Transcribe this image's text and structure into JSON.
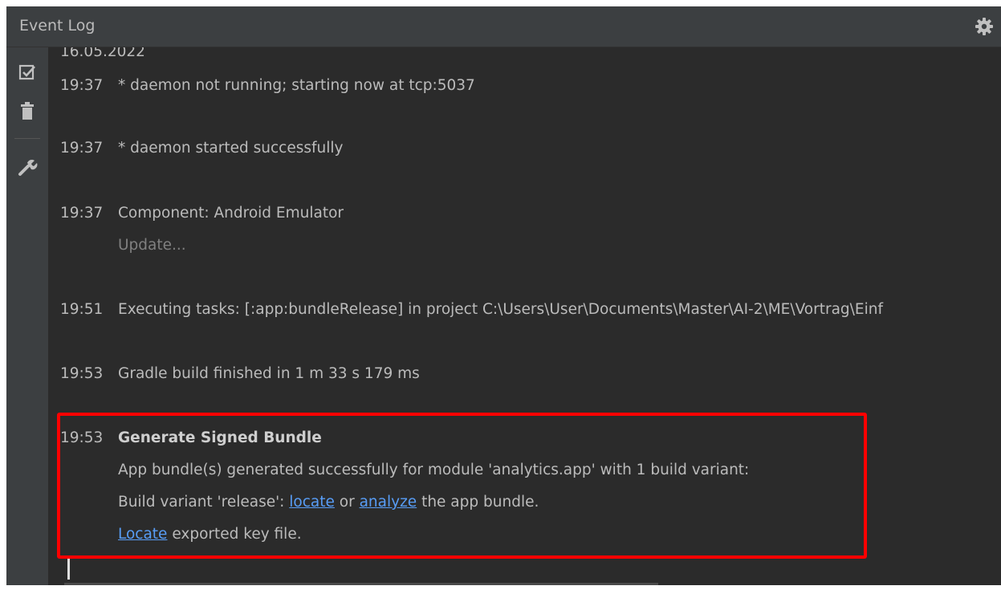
{
  "window": {
    "title": "Event Log"
  },
  "icons": {
    "settings": "gear-icon",
    "mark_read": "mark-all-read-icon",
    "clear": "trash-icon",
    "settings_tool": "wrench-icon"
  },
  "colors": {
    "background": "#2b2b2b",
    "panel": "#3c3f41",
    "text": "#bbbbbb",
    "muted": "#808080",
    "link": "#589df6",
    "highlight": "#ff0000"
  },
  "log": {
    "date": "16.05.2022",
    "entries": [
      {
        "time": "19:37",
        "message": "* daemon not running; starting now at tcp:5037"
      },
      {
        "time": "19:37",
        "message": "* daemon started successfully"
      },
      {
        "time": "19:37",
        "message": "Component: Android Emulator",
        "sub": "Update..."
      },
      {
        "time": "19:51",
        "message": "Executing tasks: [:app:bundleRelease] in project C:\\Users\\User\\Documents\\Master\\AI-2\\ME\\Vortrag\\Einf"
      },
      {
        "time": "19:53",
        "message": "Gradle build finished in 1 m 33 s 179 ms"
      }
    ],
    "bundle": {
      "time": "19:53",
      "title": "Generate Signed Bundle",
      "line1": "App bundle(s) generated successfully for module 'analytics.app' with 1 build variant:",
      "line2_prefix": "Build variant 'release': ",
      "link_locate": "locate",
      "line2_or": " or ",
      "link_analyze": "analyze",
      "line2_suffix": " the app bundle.",
      "link_locate_key": "Locate",
      "line3_suffix": " exported key file."
    }
  }
}
